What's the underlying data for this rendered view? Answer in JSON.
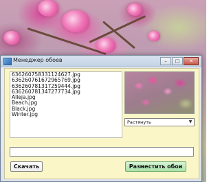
{
  "window": {
    "title": "Менеджер обоев",
    "controls": {
      "minimize": "–",
      "maximize": "□",
      "close": "✕"
    }
  },
  "file_list": {
    "items": [
      "636260758331124627.jpg",
      "636260761672965769.jpg",
      "636260781317259444.jpg",
      "636260781347277734.jpg",
      "Alleja.jpg",
      "Beach.jpg",
      "Black.jpg",
      "Winter.jpg"
    ]
  },
  "layout_select": {
    "value": "Растянуть"
  },
  "path_input": {
    "value": ""
  },
  "buttons": {
    "download": "Скачать",
    "set_wallpaper": "Разместить обои"
  },
  "icons": {
    "app": "app-icon",
    "dropdown": "chevron-down-icon"
  },
  "colors": {
    "client_bg": "#fbf6c8",
    "set_button": "#a9e2a9"
  }
}
